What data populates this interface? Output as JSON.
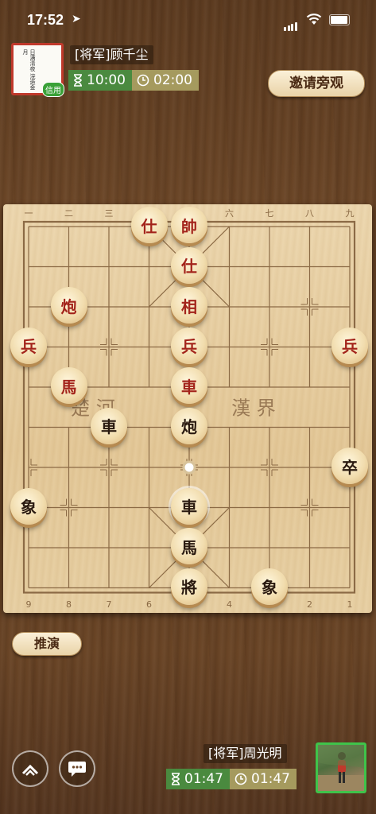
{
  "status_bar": {
    "time": "17:52"
  },
  "opponent": {
    "rank": "[将军]",
    "name": "顾千尘",
    "avatar_text": "日满清夜 浣造金月",
    "badge": "信用",
    "time_total": "10:00",
    "time_step": "02:00"
  },
  "invite_button": "邀请旁观",
  "board": {
    "top_numbers": [
      "一",
      "二",
      "三",
      "四",
      "五",
      "六",
      "七",
      "八",
      "九"
    ],
    "bottom_numbers": [
      "9",
      "8",
      "7",
      "6",
      "5",
      "4",
      "3",
      "2",
      "1"
    ],
    "river_left": "楚 河",
    "river_right": "漢 界",
    "pieces": [
      {
        "char": "仕",
        "side": "red",
        "col": 3,
        "row": 0
      },
      {
        "char": "帥",
        "side": "red",
        "col": 4,
        "row": 0
      },
      {
        "char": "仕",
        "side": "red",
        "col": 4,
        "row": 1
      },
      {
        "char": "炮",
        "side": "red",
        "col": 1,
        "row": 2
      },
      {
        "char": "相",
        "side": "red",
        "col": 4,
        "row": 2
      },
      {
        "char": "兵",
        "side": "red",
        "col": 0,
        "row": 3
      },
      {
        "char": "兵",
        "side": "red",
        "col": 4,
        "row": 3
      },
      {
        "char": "兵",
        "side": "red",
        "col": 8,
        "row": 3
      },
      {
        "char": "馬",
        "side": "red",
        "col": 1,
        "row": 4
      },
      {
        "char": "車",
        "side": "red",
        "col": 4,
        "row": 4
      },
      {
        "char": "車",
        "side": "black",
        "col": 2,
        "row": 5
      },
      {
        "char": "炮",
        "side": "black",
        "col": 4,
        "row": 5
      },
      {
        "char": "卒",
        "side": "black",
        "col": 8,
        "row": 6
      },
      {
        "char": "象",
        "side": "black",
        "col": 0,
        "row": 7
      },
      {
        "char": "車",
        "side": "black",
        "col": 4,
        "row": 7,
        "last": true
      },
      {
        "char": "馬",
        "side": "black",
        "col": 4,
        "row": 8
      },
      {
        "char": "將",
        "side": "black",
        "col": 4,
        "row": 9
      },
      {
        "char": "象",
        "side": "black",
        "col": 6,
        "row": 9
      }
    ],
    "move_marker": {
      "col": 4,
      "row": 6
    }
  },
  "deduce_button": "推演",
  "player": {
    "rank": "[将军]",
    "name": "周光明",
    "time_total": "01:47",
    "time_step": "01:47"
  },
  "icons": {
    "hourglass": "hourglass-icon",
    "clock": "clock-icon",
    "expand": "chevron-up-icon",
    "chat": "chat-bubble-icon"
  },
  "colors": {
    "red_piece": "#a3241b",
    "black_piece": "#2a1a10",
    "timer_green": "#4a8a3f",
    "timer_gold": "#a59a5e"
  }
}
